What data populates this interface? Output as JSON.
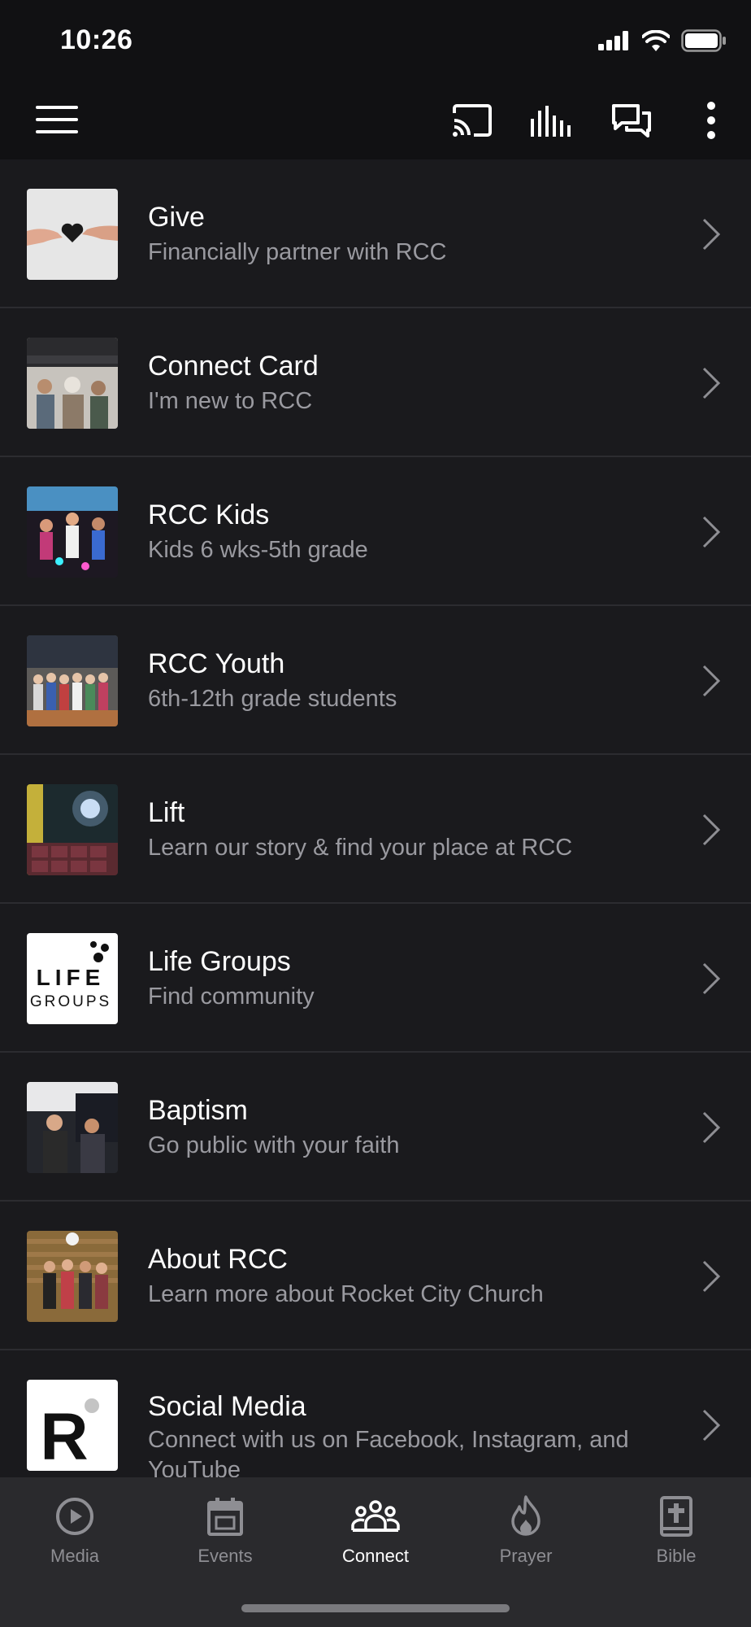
{
  "status": {
    "time": "10:26"
  },
  "header": {
    "menu_icon": "hamburger-icon",
    "actions": [
      "cast-icon",
      "audio-bars-icon",
      "chat-icon",
      "more-vertical-icon"
    ]
  },
  "items": [
    {
      "title": "Give",
      "subtitle": "Financially partner with RCC"
    },
    {
      "title": "Connect Card",
      "subtitle": "I'm new to RCC"
    },
    {
      "title": "RCC Kids",
      "subtitle": "Kids 6 wks-5th grade"
    },
    {
      "title": "RCC Youth",
      "subtitle": "6th-12th grade students"
    },
    {
      "title": "Lift",
      "subtitle": "Learn our story & find your place at RCC"
    },
    {
      "title": "Life Groups",
      "subtitle": "Find community",
      "logo_text": [
        "LIFE",
        "GROUPS"
      ]
    },
    {
      "title": "Baptism",
      "subtitle": "Go public with your faith"
    },
    {
      "title": "About RCC",
      "subtitle": "Learn more about Rocket City Church"
    },
    {
      "title": "Social Media",
      "subtitle": "Connect with us on Facebook, Instagram, and YouTube",
      "logo_text": [
        "R"
      ]
    }
  ],
  "tabs": [
    {
      "label": "Media",
      "icon": "play-circle-icon"
    },
    {
      "label": "Events",
      "icon": "calendar-icon"
    },
    {
      "label": "Connect",
      "icon": "people-icon",
      "active": true
    },
    {
      "label": "Prayer",
      "icon": "flame-icon"
    },
    {
      "label": "Bible",
      "icon": "bible-icon"
    }
  ],
  "colors": {
    "background": "#1a1a1d",
    "header": "#111113",
    "tab_bar": "#2a2a2d",
    "subtitle": "#9a9aa0",
    "divider": "#2c2c30"
  }
}
